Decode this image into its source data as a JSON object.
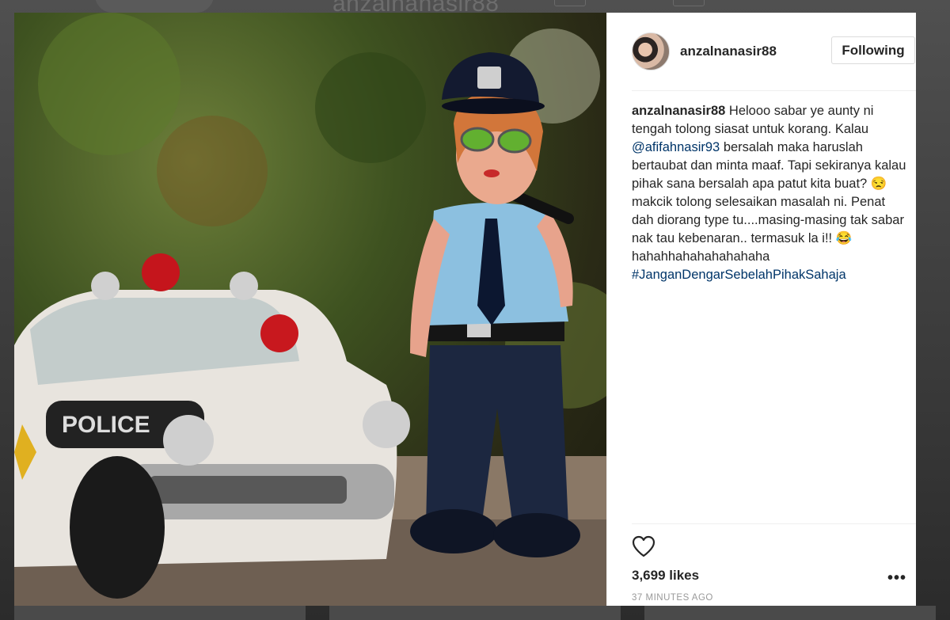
{
  "backdrop": {
    "profile_name": "anzalnanasir88"
  },
  "post": {
    "photo_alt": "police figurine and toy police car",
    "car_badge": "POLICE"
  },
  "header": {
    "username": "anzalnanasir88",
    "follow_label": "Following"
  },
  "caption": {
    "username": "anzalnanasir88",
    "text_1": "Helooo sabar ye aunty ni tengah tolong siasat untuk korang. Kalau ",
    "mention": "@afifahnasir93",
    "text_2": " bersalah maka haruslah bertaubat dan minta maaf. Tapi sekiranya kalau pihak sana bersalah apa patut kita buat? 😒 makcik tolong selesaikan masalah ni. Penat dah diorang type tu....masing-masing tak sabar nak tau kebenaran.. termasuk la i!! 😂hahahhahahahahahaha ",
    "hashtag": "#JanganDengarSebelahPihakSahaja"
  },
  "footer": {
    "likes": "3,699 likes",
    "time": "37 MINUTES AGO",
    "more_label": "•••"
  },
  "icons": {
    "like": "heart-icon",
    "more": "more-options-icon"
  },
  "colors": {
    "link": "#003569",
    "text": "#262626",
    "muted": "#999999"
  }
}
